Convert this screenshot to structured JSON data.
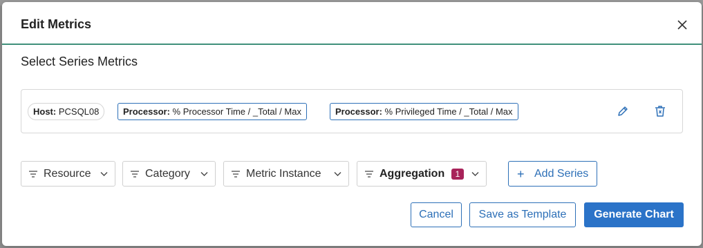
{
  "dialog": {
    "title": "Edit Metrics",
    "close_icon": "close-icon"
  },
  "section": {
    "title": "Select Series Metrics"
  },
  "series": {
    "host": {
      "key": "Host:",
      "value": "PCSQL08"
    },
    "metrics": [
      {
        "key": "Processor:",
        "value": "% Processor Time / _Total / Max"
      },
      {
        "key": "Processor:",
        "value": "% Privileged Time / _Total / Max"
      }
    ],
    "actions": [
      "edit-icon",
      "delete-icon"
    ]
  },
  "filters": [
    {
      "label": "Resource",
      "icon": "filter-icon"
    },
    {
      "label": "Category",
      "icon": "filter-icon"
    },
    {
      "label": "Metric Instance",
      "icon": "filter-icon"
    },
    {
      "label": "Aggregation",
      "icon": "filter-icon",
      "badge": "1"
    }
  ],
  "add_series": {
    "label": "Add Series",
    "icon": "plus-icon"
  },
  "footer": {
    "cancel": "Cancel",
    "save_template": "Save as Template",
    "generate": "Generate Chart"
  },
  "colors": {
    "accent": "#2c6fb7",
    "primary_button": "#2b73c8",
    "badge": "#a8235a",
    "header_rule": "#3f8f7a"
  }
}
